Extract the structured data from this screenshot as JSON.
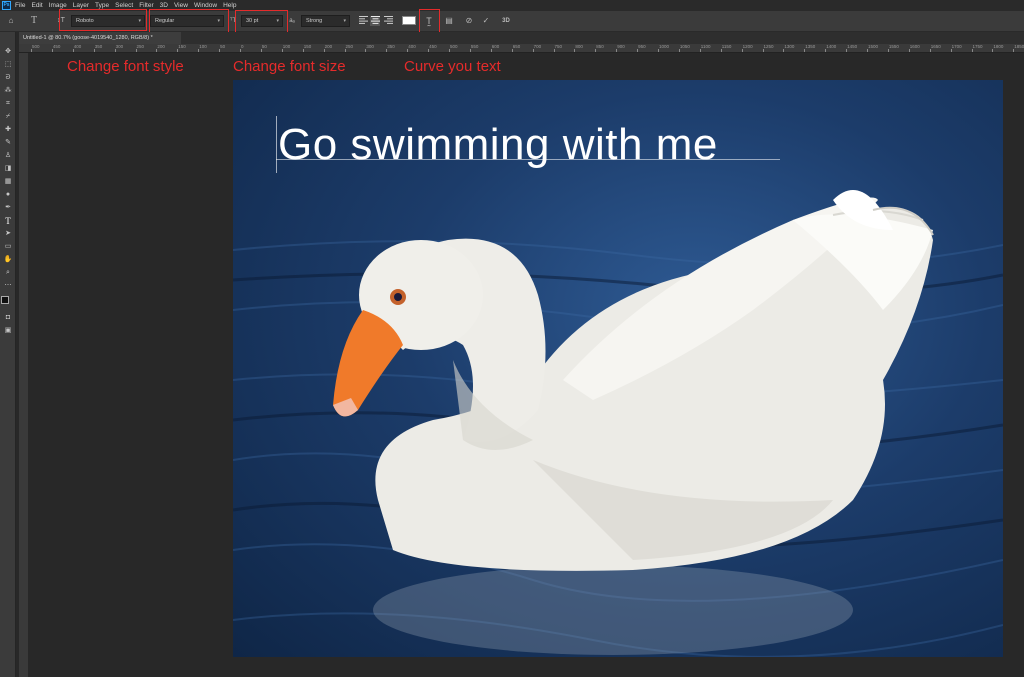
{
  "menubar": {
    "logo": "Ps",
    "items": [
      "File",
      "Edit",
      "Image",
      "Layer",
      "Type",
      "Select",
      "Filter",
      "3D",
      "View",
      "Window",
      "Help"
    ]
  },
  "options": {
    "font_family": "Roboto",
    "font_style": "Regular",
    "font_size": "30 pt",
    "antialias": "Strong",
    "aa_label": "aₐ"
  },
  "document": {
    "tab_title": "Untitled-1 @ 80.7% (goose-4019540_1280, RGB/8) *"
  },
  "ruler": {
    "ticks": [
      "500",
      "450",
      "400",
      "350",
      "300",
      "250",
      "200",
      "150",
      "100",
      "50",
      "0",
      "50",
      "100",
      "150",
      "200",
      "250",
      "300",
      "350",
      "400",
      "450",
      "500",
      "550",
      "600",
      "650",
      "700",
      "750",
      "800",
      "850",
      "900",
      "950",
      "1000",
      "1050",
      "1100",
      "1150",
      "1200",
      "1250",
      "1300",
      "1350",
      "1400",
      "1450",
      "1500",
      "1550",
      "1600",
      "1650",
      "1700",
      "1750",
      "1800",
      "1850",
      "1900"
    ]
  },
  "annotations": {
    "font_style": "Change font style",
    "font_size": "Change font size",
    "curve": "Curve you text"
  },
  "canvas": {
    "headline": "Go swimming with me"
  },
  "colors": {
    "annotation_red": "#e52b2b",
    "water_blue": "#1c3c6a",
    "beak_orange": "#f07a2a"
  }
}
